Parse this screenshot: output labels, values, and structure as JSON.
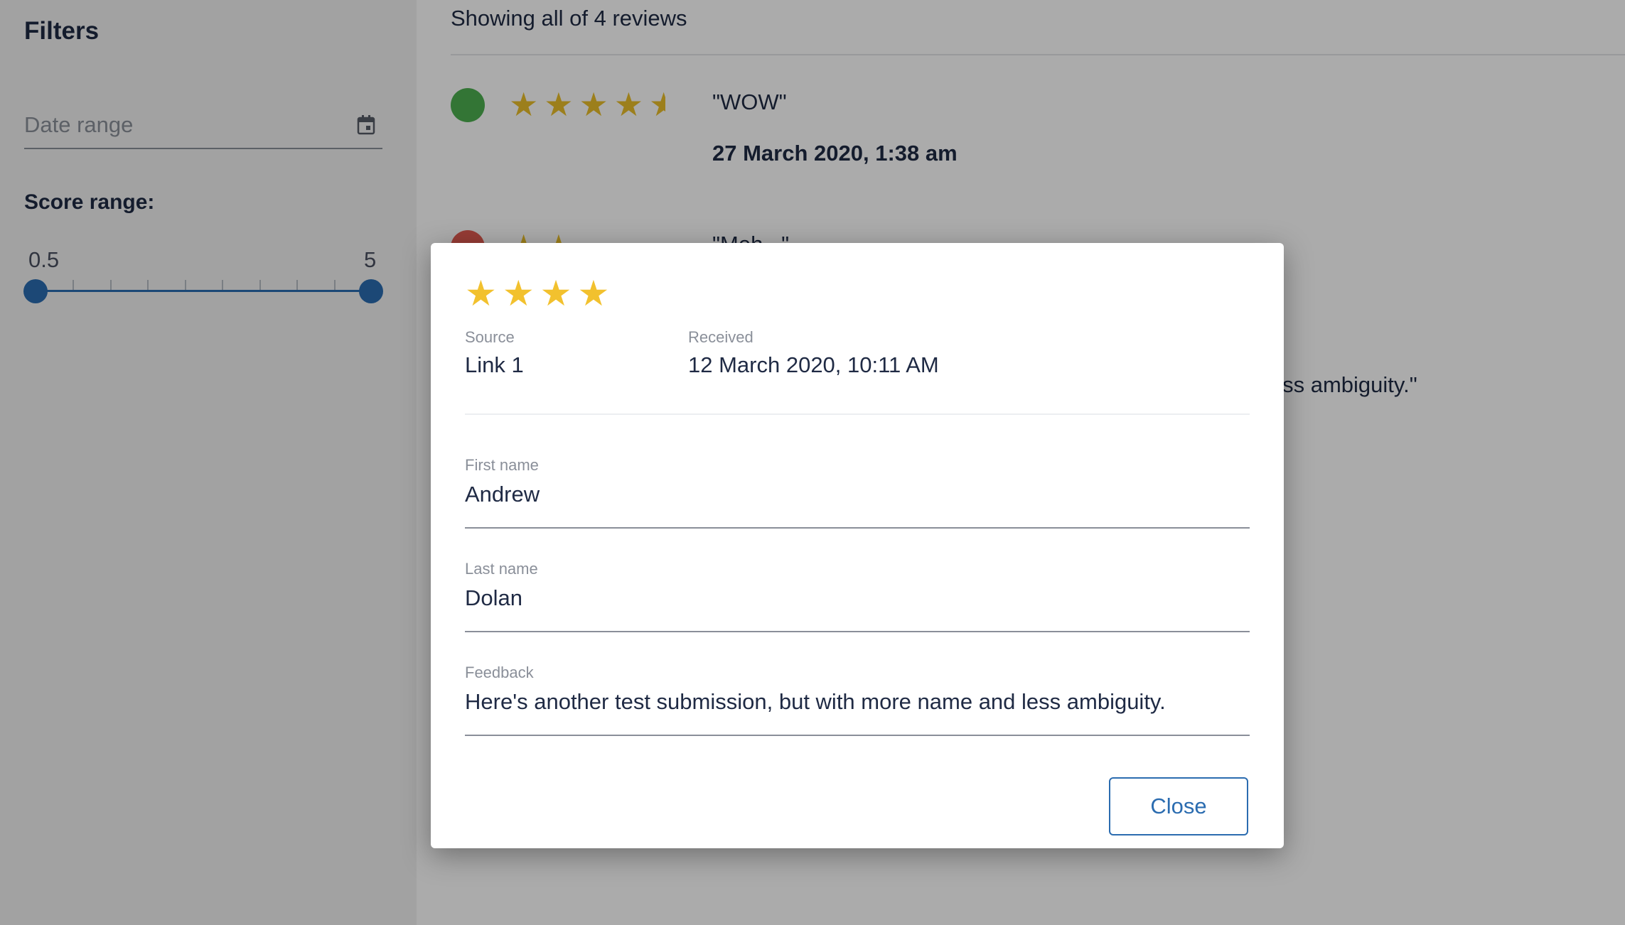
{
  "sidebar": {
    "title": "Filters",
    "date_range_placeholder": "Date range",
    "calendar_icon": "calendar-icon",
    "score_label": "Score range:",
    "slider": {
      "min": "0.5",
      "max": "5",
      "tick_count": 9
    }
  },
  "list": {
    "showing_text": "Showing all of 4 reviews",
    "reviews": [
      {
        "status_color": "#4caf50",
        "rating": 4.5,
        "title": "\"WOW\"",
        "date": "27 March 2020, 1:38 am"
      },
      {
        "status_color": "#e05a4f",
        "rating": 2,
        "title": "\"Meh...\""
      }
    ],
    "partial_snippet": "less ambiguity.\""
  },
  "modal": {
    "rating": 4,
    "source_label": "Source",
    "source_value": "Link 1",
    "received_label": "Received",
    "received_value": "12 March 2020, 10:11 AM",
    "first_name_label": "First name",
    "first_name_value": "Andrew",
    "last_name_label": "Last name",
    "last_name_value": "Dolan",
    "feedback_label": "Feedback",
    "feedback_value": "Here's another test submission, but with more name and less ambiguity.",
    "close_label": "Close"
  },
  "colors": {
    "accent": "#2b6cb0",
    "star": "#f2c12e",
    "text": "#1f2a44"
  }
}
